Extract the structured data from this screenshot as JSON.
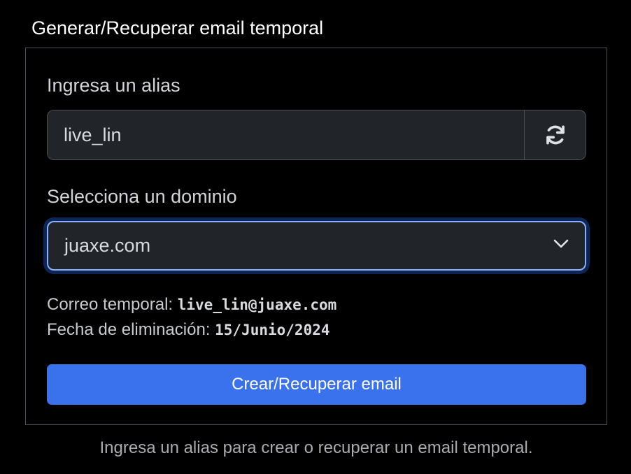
{
  "title": "Generar/Recuperar email temporal",
  "alias": {
    "label": "Ingresa un alias",
    "value": "live_lin",
    "refresh_icon": "refresh-icon"
  },
  "domain": {
    "label": "Selecciona un dominio",
    "selected": "juaxe.com",
    "chevron_icon": "chevron-down-icon"
  },
  "info": {
    "email_label": "Correo temporal:",
    "email_value": "live_lin@juaxe.com",
    "date_label": "Fecha de eliminación:",
    "date_value": "15/Junio/2024"
  },
  "submit_label": "Crear/Recuperar email",
  "help_text": "Ingresa un alias para crear o recuperar un email temporal.",
  "colors": {
    "accent": "#3a71ec",
    "focus_border": "#8bb0f5",
    "input_bg": "#212529",
    "background": "#000000"
  }
}
